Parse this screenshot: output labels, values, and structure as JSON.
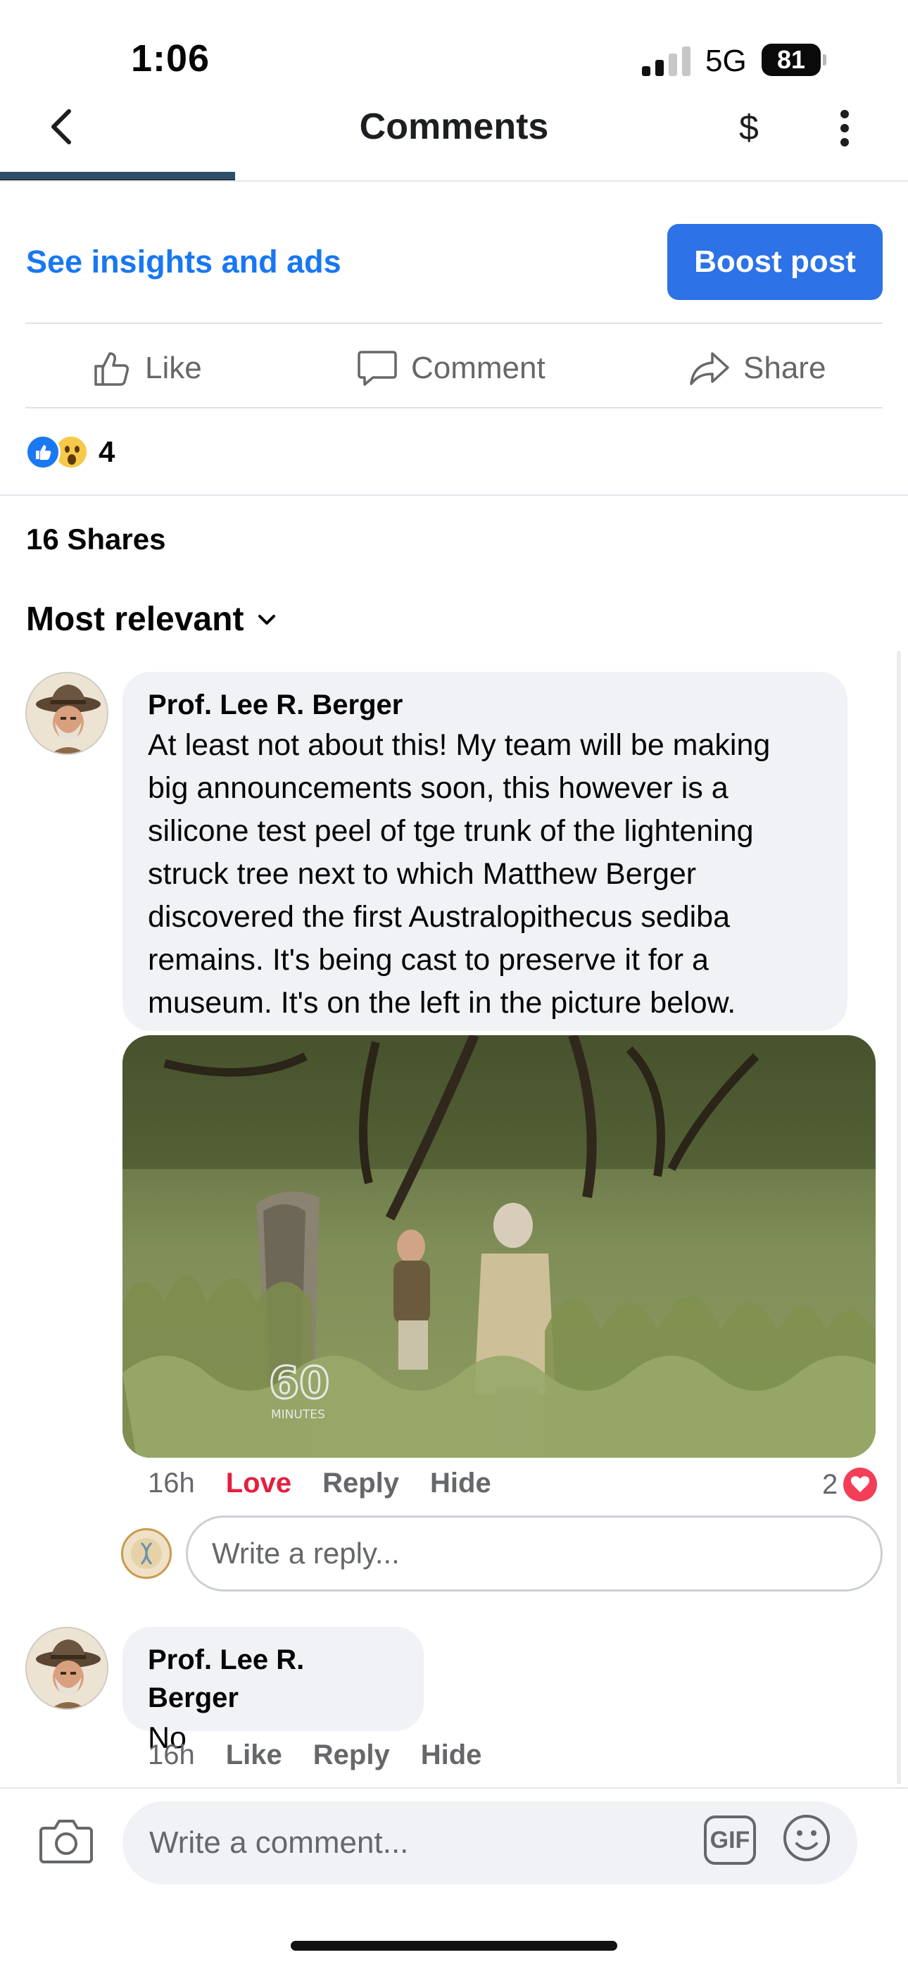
{
  "status_bar": {
    "time": "1:06",
    "network": "5G",
    "battery": "81"
  },
  "nav": {
    "title": "Comments",
    "dollar": "$"
  },
  "post_actions": {
    "insights_label": "See insights and ads",
    "boost_label": "Boost post",
    "like_label": "Like",
    "comment_label": "Comment",
    "share_label": "Share"
  },
  "reactions": {
    "count": "4",
    "types": [
      "like",
      "wow"
    ]
  },
  "shares": "16 Shares",
  "sort": {
    "label": "Most relevant"
  },
  "comments": [
    {
      "author": "Prof. Lee R. Berger",
      "text": "At least not about this! My team will be making\nbig announcements soon, this however is a\nsilicone test peel of tge trunk of the lightening\nstruck tree next to which Matthew Berger\ndiscovered the first Australopithecus sediba\nremains. It's being cast to preserve it for a\nmuseum. It's on the left in the picture below.",
      "photo_watermark": "60",
      "photo_watermark_sub": "MINUTES",
      "time": "16h",
      "reaction_label": "Love",
      "reply_label": "Reply",
      "hide_label": "Hide",
      "reaction_count": "2"
    },
    {
      "author": "Prof. Lee R. Berger",
      "text": "No",
      "time": "16h",
      "reaction_label": "Like",
      "reply_label": "Reply",
      "hide_label": "Hide"
    }
  ],
  "reply_box": {
    "placeholder": "Write a reply..."
  },
  "composer": {
    "placeholder": "Write a comment...",
    "gif_label": "GIF"
  },
  "colors": {
    "accent": "#1877f2",
    "boost": "#2d72e6",
    "love": "#e41e3f",
    "bubble": "#f0f2f5",
    "muted": "#65676b"
  },
  "icons": [
    "back-icon",
    "dollar-icon",
    "more-icon",
    "like-icon",
    "comment-icon",
    "share-icon",
    "chevron-down-icon",
    "heart-icon",
    "camera-icon",
    "gif-icon",
    "emoji-icon"
  ]
}
